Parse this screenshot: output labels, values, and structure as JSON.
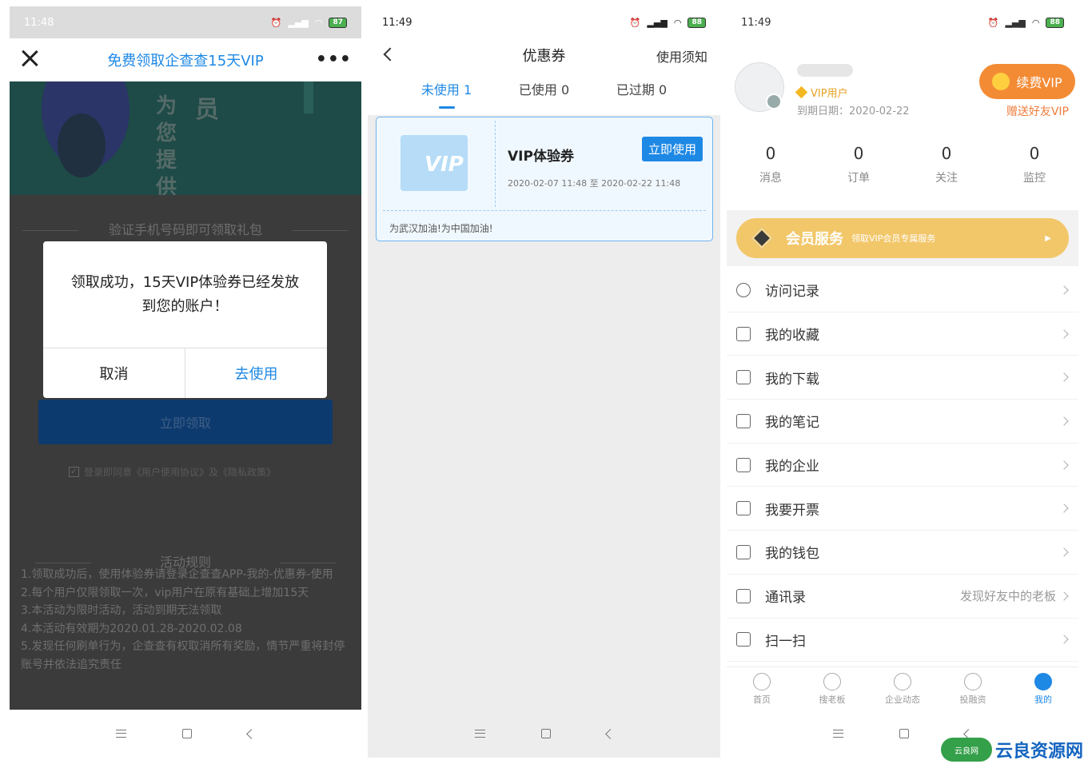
{
  "phone1": {
    "time": "11:48",
    "battery": "87",
    "title": "免费领取企查查15天VIP",
    "banner_chars": "为您提供",
    "banner_chars2": "员",
    "verify_title": "验证手机号码即可领取礼包",
    "claim_button": "立即领取",
    "agreement": "登录即同意《用户使用协议》及《隐私政策》",
    "rules_title": "活动规则",
    "rules": [
      "1.领取成功后，使用体验券请登录企查查APP-我的-优惠券-使用",
      "2.每个用户仅限领取一次，vip用户在原有基础上增加15天",
      "3.本活动为限时活动，活动到期无法领取",
      "4.本活动有效期为2020.01.28-2020.02.08",
      "5.发现任何刷单行为，企查查有权取消所有奖励，情节严重将封停账号并依法追究责任"
    ],
    "dialog": {
      "message": "领取成功，15天VIP体验券已经发放到您的账户！",
      "cancel": "取消",
      "go_use": "去使用"
    }
  },
  "phone2": {
    "time": "11:49",
    "battery": "88",
    "title": "优惠券",
    "notice": "使用须知",
    "tabs": [
      {
        "label": "未使用 1",
        "active": true
      },
      {
        "label": "已使用 0",
        "active": false
      },
      {
        "label": "已过期 0",
        "active": false
      }
    ],
    "coupon": {
      "icon_text": "VIP",
      "name": "VIP体验券",
      "use_button": "立即使用",
      "period": "2020-02-07 11:48 至 2020-02-22 11:48",
      "slogan": "为武汉加油!为中国加油!"
    }
  },
  "phone3": {
    "time": "11:49",
    "battery": "88",
    "vip_label": "VIP用户",
    "expire": "到期日期：2020-02-22",
    "renew_button": "续费VIP",
    "gift_link": "赠送好友VIP",
    "stats": [
      {
        "num": "0",
        "label": "消息"
      },
      {
        "num": "0",
        "label": "订单"
      },
      {
        "num": "0",
        "label": "关注"
      },
      {
        "num": "0",
        "label": "监控"
      }
    ],
    "vip_service": {
      "title": "会员服务",
      "subtitle": "领取VIP会员专属服务"
    },
    "menu": [
      {
        "label": "访问记录",
        "icon": "clock-icon",
        "extra": ""
      },
      {
        "label": "我的收藏",
        "icon": "star-icon",
        "extra": ""
      },
      {
        "label": "我的下载",
        "icon": "download-icon",
        "extra": ""
      },
      {
        "label": "我的笔记",
        "icon": "note-icon",
        "extra": ""
      },
      {
        "label": "我的企业",
        "icon": "building-icon",
        "extra": ""
      },
      {
        "label": "我要开票",
        "icon": "invoice-icon",
        "extra": ""
      },
      {
        "label": "我的钱包",
        "icon": "wallet-icon",
        "extra": ""
      },
      {
        "label": "通讯录",
        "icon": "contacts-icon",
        "extra": "发现好友中的老板"
      },
      {
        "label": "扫一扫",
        "icon": "scan-icon",
        "extra": ""
      }
    ],
    "tabbar": [
      {
        "label": "首页",
        "icon": "home-icon",
        "active": false
      },
      {
        "label": "搜老板",
        "icon": "boss-icon",
        "active": false
      },
      {
        "label": "企业动态",
        "icon": "news-icon",
        "active": false
      },
      {
        "label": "投融资",
        "icon": "finance-icon",
        "active": false
      },
      {
        "label": "我的",
        "icon": "profile-icon",
        "active": true
      }
    ]
  },
  "watermark": {
    "badge": "云良网",
    "text": "云良资源网"
  },
  "colors": {
    "accent": "#1e88e5",
    "vip_gold": "#f2c76a",
    "renew_orange": "#f38b35"
  }
}
